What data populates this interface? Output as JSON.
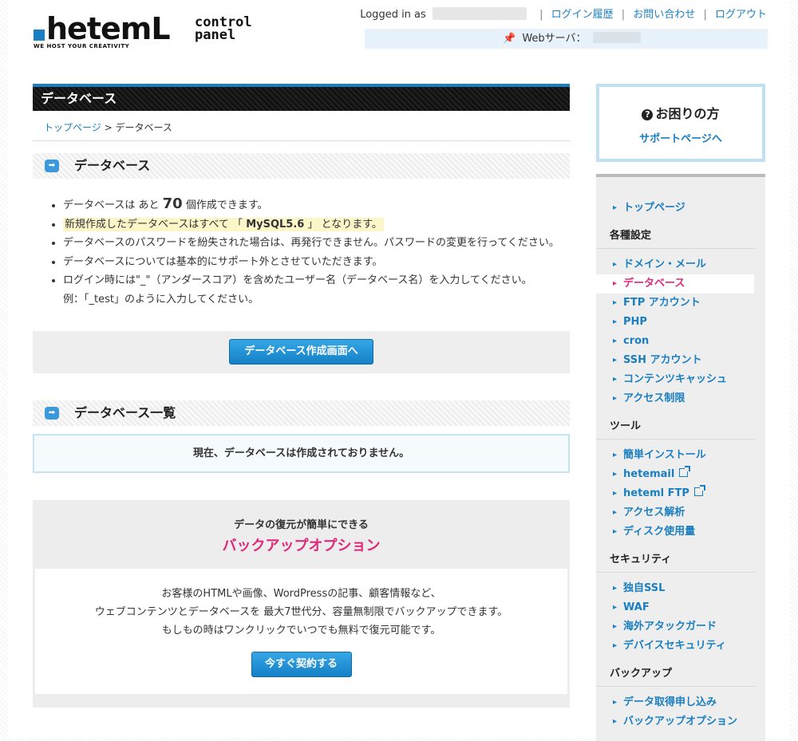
{
  "header": {
    "logo_text": "hetemL",
    "logo_tagline": "WE HOST YOUR CREATIVITY",
    "logo_cp": "control panel",
    "logged_in_label": "Logged in as",
    "nav": [
      "ログイン履歴",
      "お問い合わせ",
      "ログアウト"
    ],
    "server_label": "Webサーバ："
  },
  "main": {
    "title": "データベース",
    "breadcrumb": {
      "home": "トップページ",
      "sep": " > ",
      "current": "データベース"
    },
    "section1": "データベース",
    "notes": {
      "n1_pre": "データベースは あと ",
      "n1_num": "70",
      "n1_post": " 個作成できます。",
      "n2_pre": "新規作成したデータベースはすべて 「 ",
      "n2_val": "MySQL5.6",
      "n2_post": " 」 となります。",
      "n3": "データベースのパスワードを紛失された場合は、再発行できません。パスワードの変更を行ってください。",
      "n4": "データベースについては基本的にサポート外とさせていただきます。",
      "n5a": "ログイン時には\"_\"（アンダースコア）を含めたユーザー名（データベース名）を入力してください。",
      "n5b": "例：「_test」のように入力してください。"
    },
    "create_button": "データベース作成画面へ",
    "section2": "データベース一覧",
    "empty_message": "現在、データベースは作成されておりません。",
    "backup": {
      "sub": "データの復元が簡単にできる",
      "title": "バックアップオプション",
      "line1": "お客様のHTMLや画像、WordPressの記事、顧客情報など、",
      "line2": "ウェブコンテンツとデータベースを 最大7世代分、容量無制限でバックアップできます。",
      "line3": "もしもの時はワンクリックでいつでも無料で復元可能です。",
      "button": "今すぐ契約する"
    }
  },
  "sidebar": {
    "help_title": "お困りの方",
    "help_link": "サポートページへ",
    "top": "トップページ",
    "settings_head": "各種設定",
    "settings": [
      "ドメイン・メール",
      "データベース",
      "FTP アカウント",
      "PHP",
      "cron",
      "SSH アカウント",
      "コンテンツキャッシュ",
      "アクセス制限"
    ],
    "tools_head": "ツール",
    "tools": [
      "簡単インストール",
      "hetemail",
      "heteml FTP",
      "アクセス解析",
      "ディスク使用量"
    ],
    "security_head": "セキュリティ",
    "security": [
      "独自SSL",
      "WAF",
      "海外アタックガード",
      "デバイスセキュリティ"
    ],
    "backup_head": "バックアップ",
    "backup": [
      "データ取得申し込み",
      "バックアップオプション"
    ]
  },
  "colors": {
    "accent": "#1a7fc1",
    "pink": "#e0287a",
    "title_bar": "#111111"
  }
}
